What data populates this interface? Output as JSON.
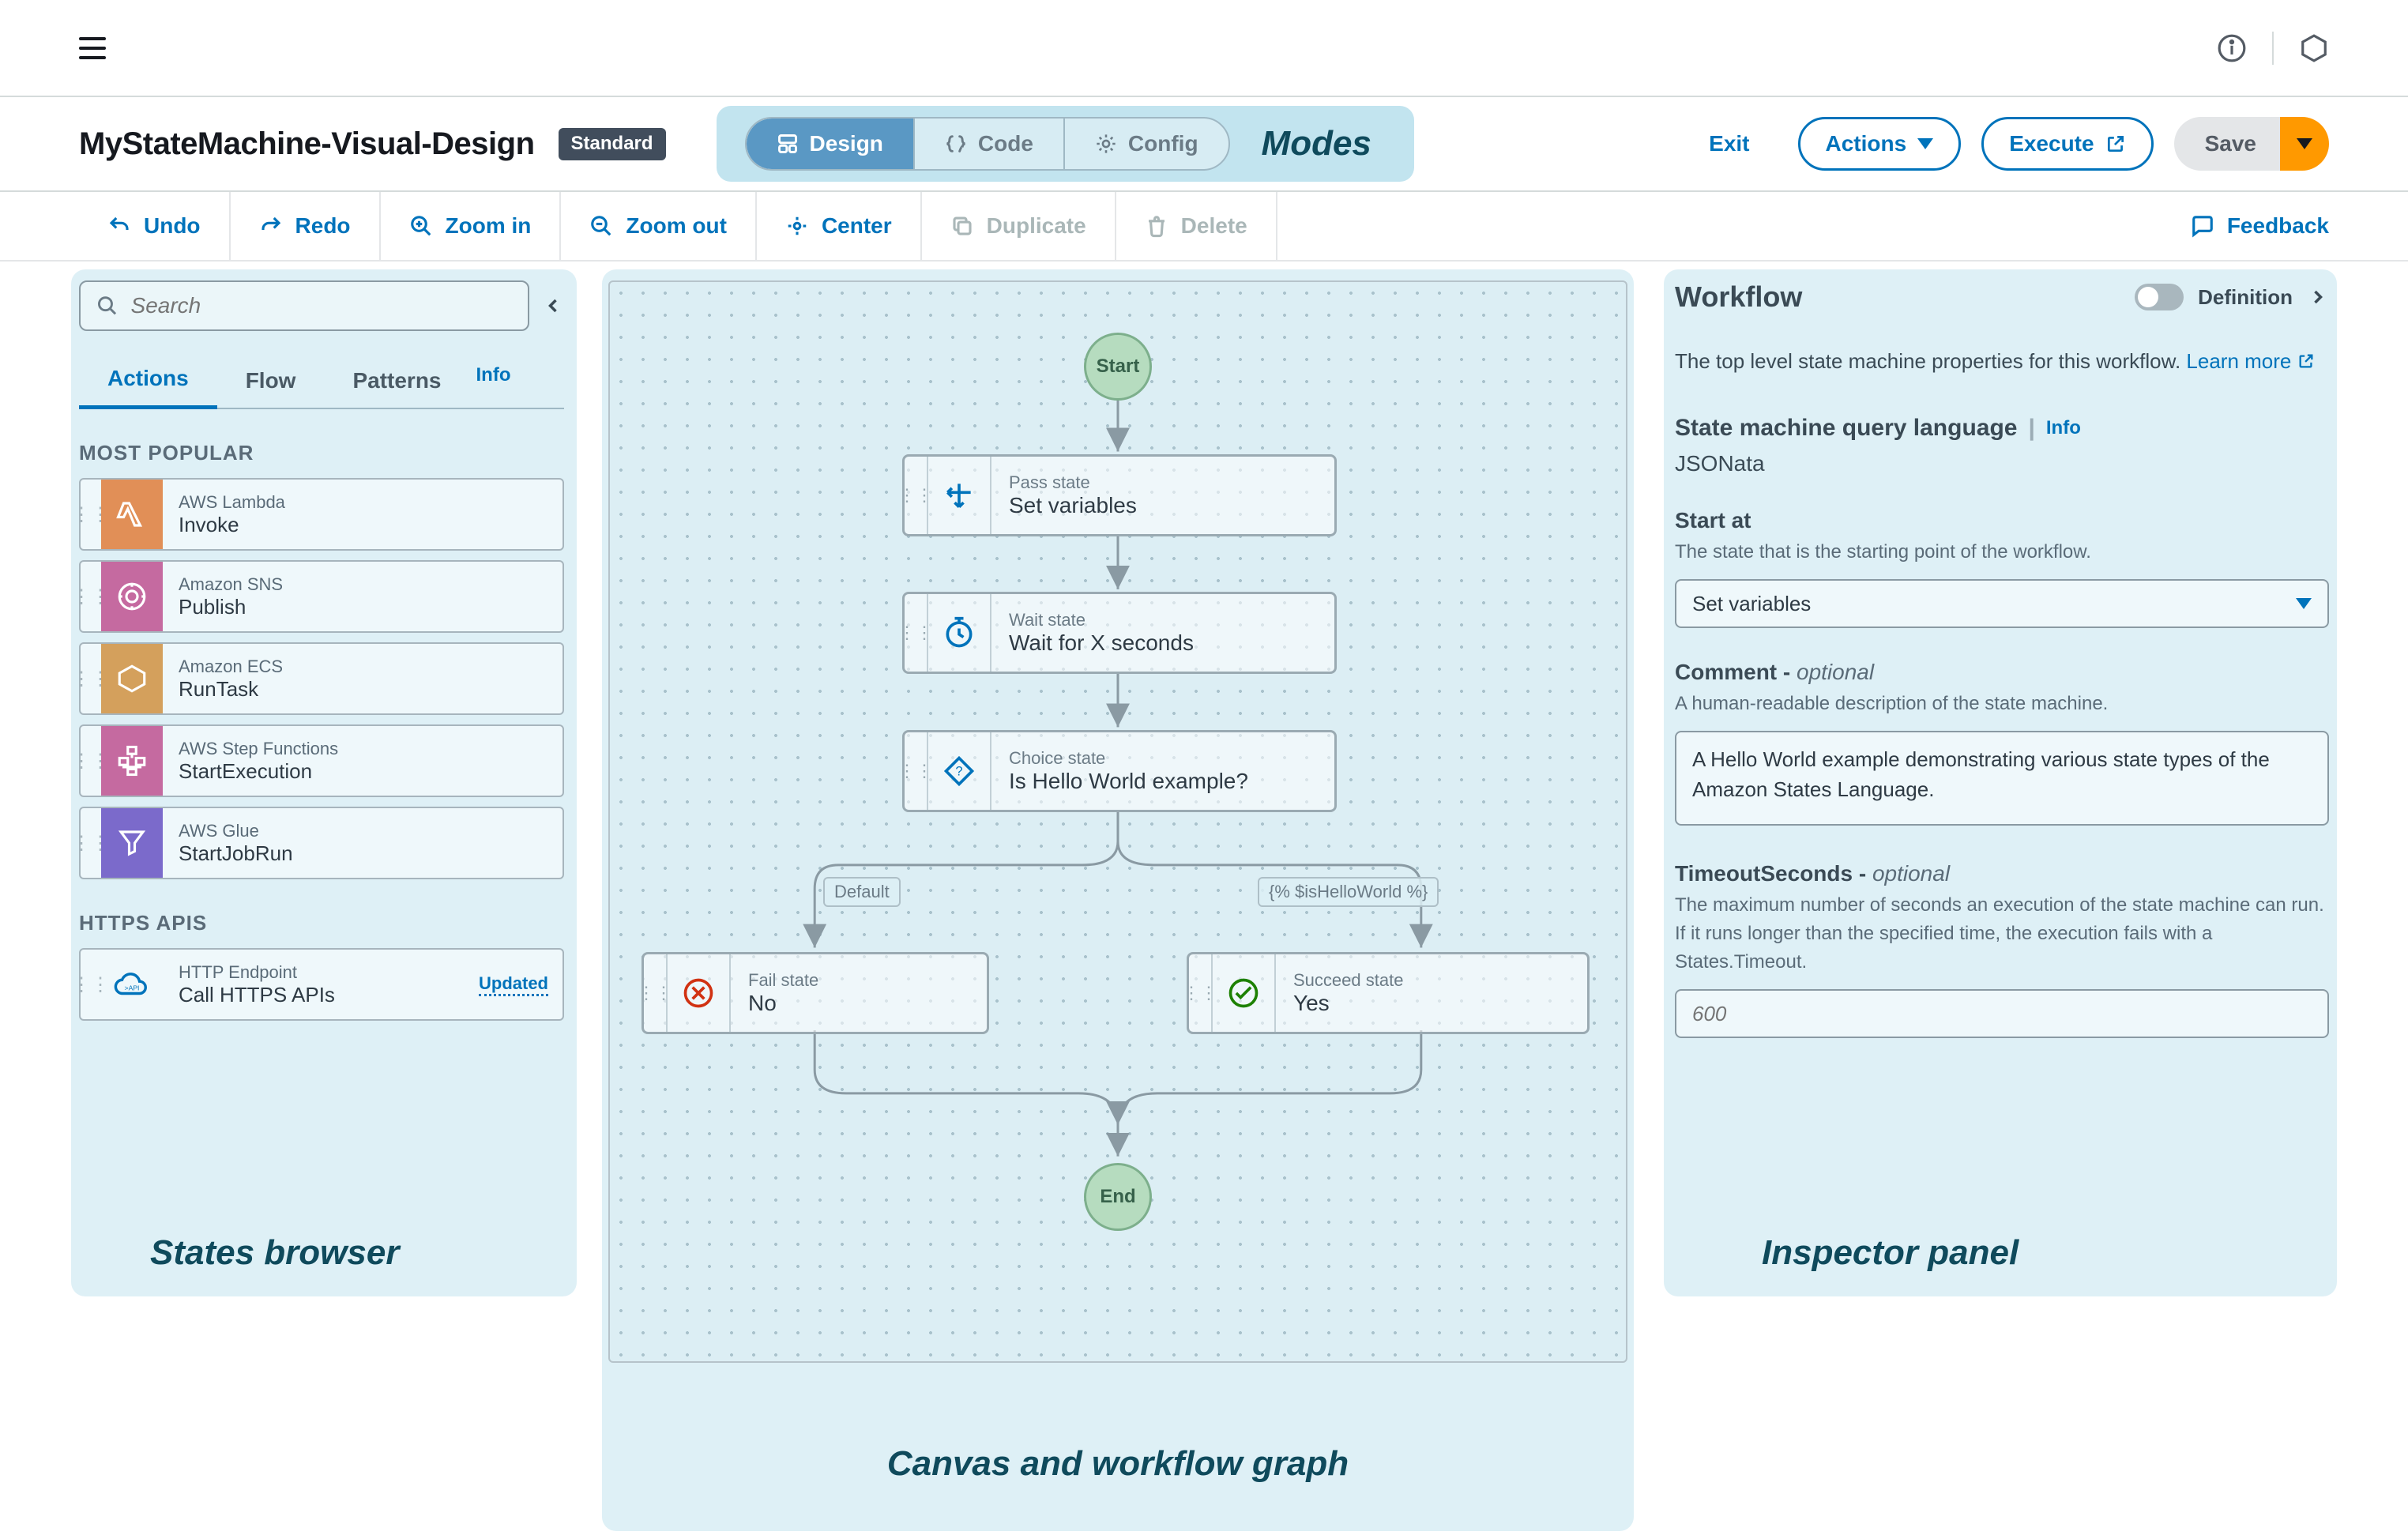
{
  "page_title": "MyStateMachine-Visual-Design",
  "type_badge": "Standard",
  "modes": {
    "design": "Design",
    "code": "Code",
    "config": "Config",
    "callout": "Modes"
  },
  "header_actions": {
    "exit": "Exit",
    "actions": "Actions",
    "execute": "Execute",
    "save": "Save"
  },
  "toolbar": {
    "undo": "Undo",
    "redo": "Redo",
    "zoom_in": "Zoom in",
    "zoom_out": "Zoom out",
    "center": "Center",
    "duplicate": "Duplicate",
    "delete": "Delete",
    "feedback": "Feedback"
  },
  "sidebar": {
    "search_placeholder": "Search",
    "tabs": {
      "actions": "Actions",
      "flow": "Flow",
      "patterns": "Patterns",
      "info": "Info"
    },
    "section_popular": "MOST POPULAR",
    "section_https": "HTTPS APIS",
    "states": [
      {
        "service": "AWS Lambda",
        "action": "Invoke",
        "color": "#e18f57"
      },
      {
        "service": "Amazon SNS",
        "action": "Publish",
        "color": "#c56aa0"
      },
      {
        "service": "Amazon ECS",
        "action": "RunTask",
        "color": "#d4a05c"
      },
      {
        "service": "AWS Step Functions",
        "action": "StartExecution",
        "color": "#c56aa0"
      },
      {
        "service": "AWS Glue",
        "action": "StartJobRun",
        "color": "#7b6acb"
      }
    ],
    "https_state": {
      "service": "HTTP Endpoint",
      "action": "Call HTTPS APIs",
      "badge": "Updated"
    },
    "callout": "States browser"
  },
  "canvas": {
    "start_label": "Start",
    "end_label": "End",
    "nodes": {
      "pass": {
        "type": "Pass state",
        "title": "Set variables"
      },
      "wait": {
        "type": "Wait state",
        "title": "Wait for X seconds"
      },
      "choice": {
        "type": "Choice state",
        "title": "Is Hello World example?"
      },
      "fail": {
        "type": "Fail state",
        "title": "No"
      },
      "succeed": {
        "type": "Succeed state",
        "title": "Yes"
      }
    },
    "edge_labels": {
      "default": "Default",
      "cond": "{% $isHelloWorld %}"
    },
    "callout": "Canvas and workflow graph"
  },
  "inspector": {
    "title": "Workflow",
    "toggle_label": "Definition",
    "intro_text": "The top level state machine properties for this workflow. ",
    "learn_more": "Learn more",
    "lang_title": "State machine query language",
    "lang_info": "Info",
    "lang_value": "JSONata",
    "start_at_label": "Start at",
    "start_at_help": "The state that is the starting point of the workflow.",
    "start_at_value": "Set variables",
    "comment_label": "Comment - ",
    "optional_word": "optional",
    "comment_help": "A human-readable description of the state machine.",
    "comment_value": "A Hello World example demonstrating various state types of the Amazon States Language.",
    "timeout_label": "TimeoutSeconds - ",
    "timeout_help": "The maximum number of seconds an execution of the state machine can run. If it runs longer than the specified time, the execution fails with a States.Timeout.",
    "timeout_placeholder": "600",
    "callout": "Inspector panel"
  }
}
